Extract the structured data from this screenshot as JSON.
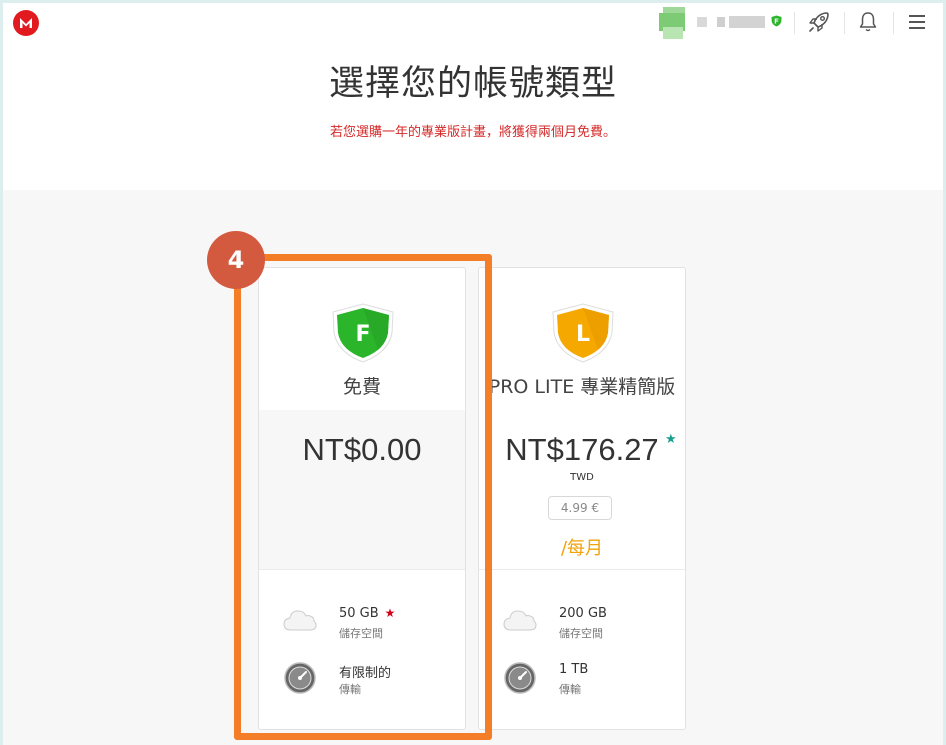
{
  "header": {
    "title": "選擇您的帳號類型",
    "promo": "若您選購一年的專業版計畫，將獲得兩個月免費。",
    "account_badge_letter": "F"
  },
  "icons": {
    "logo": "mega-logo",
    "rocket": "rocket-icon",
    "bell": "bell-icon",
    "menu": "hamburger-menu-icon"
  },
  "plans": [
    {
      "badge_letter": "F",
      "badge_color": "#2bb52b",
      "name": "免費",
      "price": "NT$0.00",
      "storage_value": "50 GB",
      "storage_star": "★",
      "storage_label": "儲存空間",
      "transfer_value": "有限制的",
      "transfer_label": "傳輸"
    },
    {
      "badge_letter": "L",
      "badge_color": "#f5a800",
      "name": "PRO LITE 專業精簡版",
      "price": "NT$176.27",
      "price_star": "★",
      "currency": "TWD",
      "euro_price": "4.99 €",
      "period": "/每月",
      "storage_value": "200 GB",
      "storage_label": "儲存空間",
      "transfer_value": "1 TB",
      "transfer_label": "傳輸"
    }
  ],
  "annotation": {
    "step_number": "4",
    "highlight_color": "#f47e28"
  }
}
